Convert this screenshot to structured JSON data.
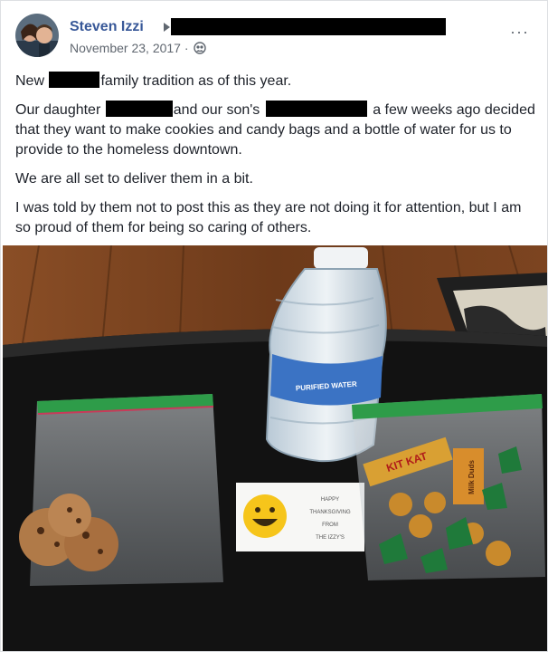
{
  "post": {
    "author": "Steven Izzi",
    "date": "November 23, 2017",
    "separator": "·",
    "more_label": "···",
    "paragraphs": [
      {
        "before": "New",
        "after": "family tradition as of this year."
      },
      {
        "before": "Our daughter",
        "middle": "and our son's",
        "after": "a few weeks ago decided that they want to make cookies and candy bags and a bottle of water for us to provide to the homeless downtown."
      },
      {
        "text": "We are all set to deliver them in a bit."
      },
      {
        "text": "I was told by them not to post this as they are not doing it for attention, but I am so proud of them for being so caring of others."
      }
    ]
  },
  "photo": {
    "bottle_label": "PURIFIED WATER",
    "card_lines": [
      "HAPPY",
      "THANKSGIVING",
      "FROM",
      "THE IZZY'S"
    ],
    "candy_brand": "KIT KAT",
    "milk_duds": "Milk Duds"
  },
  "colors": {
    "link": "#385898",
    "meta": "#606770",
    "text": "#1d2129",
    "table": "#111111",
    "floor": "#7a4521",
    "zip_green": "#2e9c49"
  },
  "icons": {
    "audience": "friends-icon",
    "more": "more-options-icon",
    "arrow": "arrow-right-icon"
  }
}
